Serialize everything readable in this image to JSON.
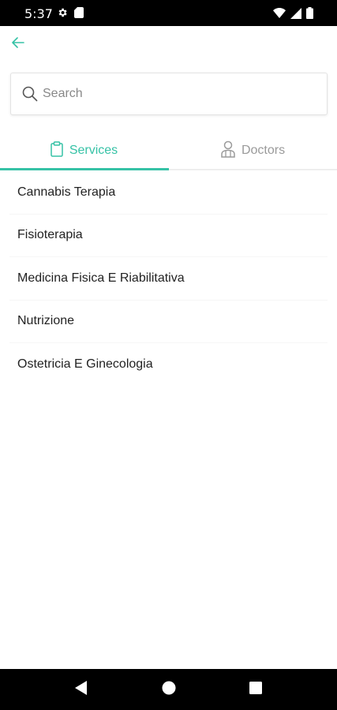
{
  "status_bar": {
    "time": "5:37"
  },
  "search": {
    "placeholder": "Search"
  },
  "tabs": [
    {
      "label": "Services",
      "icon": "clipboard-icon",
      "active": true
    },
    {
      "label": "Doctors",
      "icon": "doctor-icon",
      "active": false
    }
  ],
  "services": [
    "Cannabis Terapia",
    "Fisioterapia",
    "Medicina Fisica E Riabilitativa",
    "Nutrizione",
    "Ostetricia E Ginecologia"
  ],
  "colors": {
    "accent": "#36c2a6",
    "inactive": "#9a9a9a",
    "text": "#222222"
  }
}
